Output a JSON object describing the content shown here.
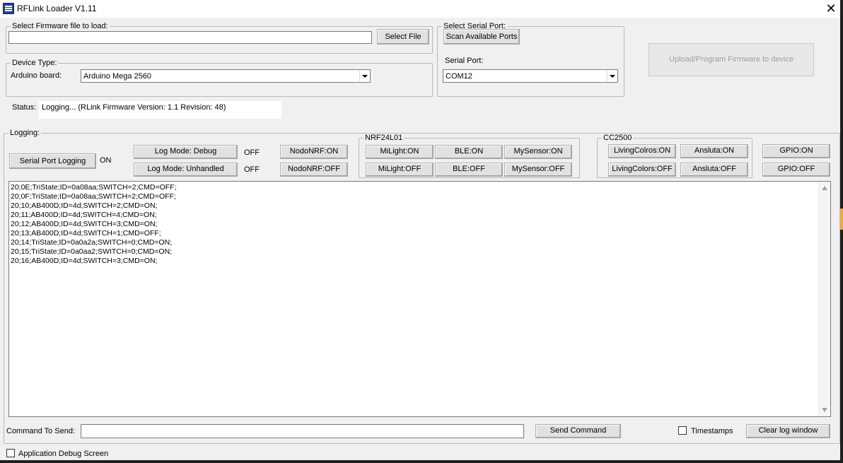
{
  "window": {
    "title": "RFLink Loader V1.11",
    "close_glyph": "✕"
  },
  "firmware": {
    "legend": "Select Firmware file to load:",
    "path_value": "",
    "select_file_label": "Select File"
  },
  "serial": {
    "legend": "Select Serial Port:",
    "scan_label": "Scan Available Ports",
    "port_label": "Serial Port:",
    "port_value": "COM12"
  },
  "upload": {
    "label": "Upload/Program Firmware to device"
  },
  "device": {
    "legend": "Device Type:",
    "board_label": "Arduino board:",
    "board_value": "Arduino Mega 2560"
  },
  "status": {
    "label": "Status:",
    "value": "Logging... (RLink Firmware Version: 1.1 Revision: 48)"
  },
  "logging": {
    "legend": "Logging:",
    "serial_logging_label": "Serial Port Logging",
    "serial_logging_state": "ON",
    "log_debug_label": "Log Mode: Debug",
    "log_debug_state": "OFF",
    "log_unhandled_label": "Log Mode: Unhandled",
    "log_unhandled_state": "OFF",
    "nodo_on": "NodoNRF:ON",
    "nodo_off": "NodoNRF:OFF",
    "nrf_legend": "NRF24L01",
    "milight_on": "MiLight:ON",
    "milight_off": "MiLight:OFF",
    "ble_on": "BLE:ON",
    "ble_off": "BLE:OFF",
    "mysensor_on": "MySensor:ON",
    "mysensor_off": "MySensor:OFF",
    "cc_legend": "CC2500",
    "livingcolors_on": "LivingColros:ON",
    "livingcolors_off": "LivingColors:OFF",
    "ansluta_on": "Ansluta:ON",
    "ansluta_off": "Ansluta:OFF",
    "gpio_on": "GPIO:ON",
    "gpio_off": "GPIO:OFF"
  },
  "log_lines": [
    "20;0E;TriState;ID=0a08aa;SWITCH=2;CMD=OFF;",
    "20;0F;TriState;ID=0a08aa;SWITCH=2;CMD=OFF;",
    "20;10;AB400D;ID=4d;SWITCH=2;CMD=ON;",
    "20;11;AB400D;ID=4d;SWITCH=4;CMD=ON;",
    "20;12;AB400D;ID=4d;SWITCH=3;CMD=ON;",
    "20;13;AB400D;ID=4d;SWITCH=1;CMD=OFF;",
    "20;14;TriState;ID=0a0a2a;SWITCH=0;CMD=ON;",
    "20;15;TriState;ID=0a0aa2;SWITCH=0;CMD=ON;",
    "20;16;AB400D;ID=4d;SWITCH=3;CMD=ON;"
  ],
  "command": {
    "label": "Command To Send:",
    "value": "",
    "send_label": "Send Command",
    "timestamps_label": "Timestamps",
    "clear_label": "Clear log window"
  },
  "debug": {
    "label": "Application Debug Screen"
  },
  "icons": {
    "app": "rflink-app-icon",
    "close": "close-icon",
    "dropdown": "chevron-down-icon",
    "scroll_up": "scroll-up-icon",
    "scroll_down": "scroll-down-icon"
  }
}
